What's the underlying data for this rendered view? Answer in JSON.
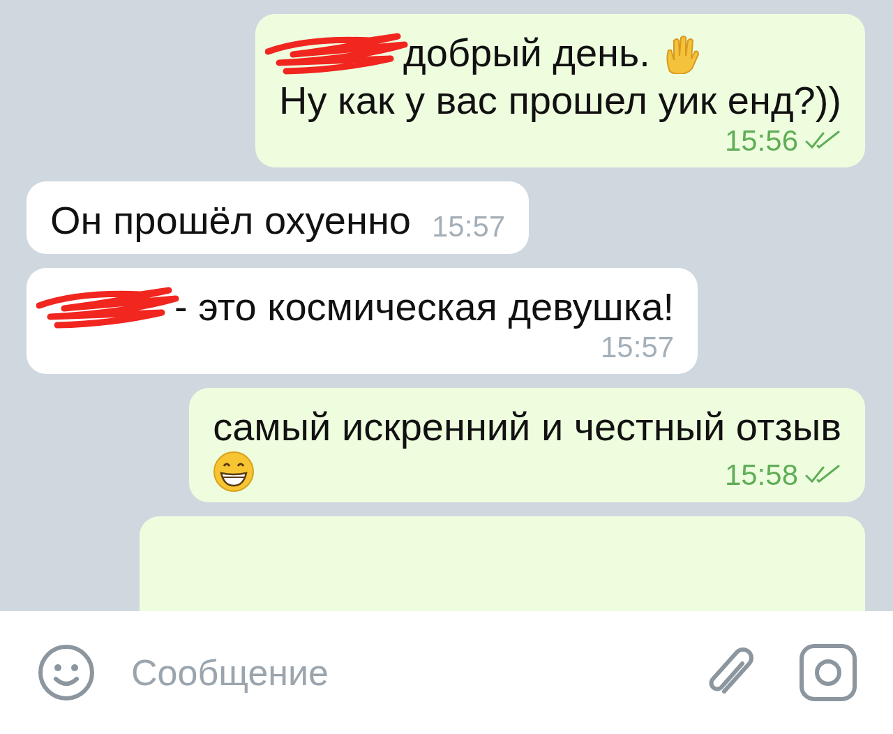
{
  "messages": [
    {
      "outgoing": true,
      "time_below": true,
      "time": "15:56",
      "read": true,
      "lines": [
        [
          {
            "kind": "redaction"
          },
          {
            "kind": "text",
            "text": "добрый день."
          },
          {
            "kind": "hand"
          }
        ],
        [
          {
            "kind": "text",
            "text": "Ну как у вас прошел уик енд?))"
          }
        ]
      ]
    },
    {
      "outgoing": false,
      "time_below": false,
      "time": "15:57",
      "lines": [
        [
          {
            "kind": "text",
            "text": "Он прошёл охуенно"
          }
        ]
      ]
    },
    {
      "outgoing": false,
      "time_below": true,
      "time": "15:57",
      "lines": [
        [
          {
            "kind": "redaction"
          },
          {
            "kind": "text",
            "text": "- это космическая девушка!"
          }
        ]
      ]
    },
    {
      "outgoing": true,
      "time_below": false,
      "time": "15:58",
      "read": true,
      "lines": [
        [
          {
            "kind": "text",
            "text": "самый искренний и честный отзыв"
          }
        ],
        [
          {
            "kind": "grin"
          }
        ]
      ]
    },
    {
      "outgoing": true,
      "cut_off": true
    }
  ],
  "composer": {
    "placeholder": "Сообщение"
  }
}
